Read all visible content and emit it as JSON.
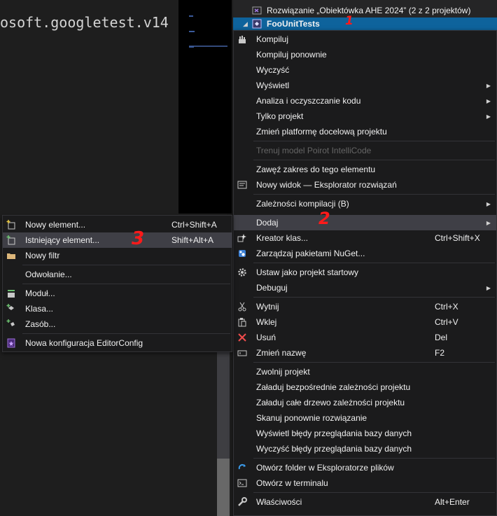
{
  "editor": {
    "code_fragment": "osoft.googletest.v14"
  },
  "solution": {
    "solution_label": "Rozwiązanie „Obiektówka AHE 2024” (2 z 2 projektów)",
    "project_label": "FooUnitTests"
  },
  "context_menu": {
    "items": [
      {
        "label": "Kompiluj",
        "icon": "build-icon"
      },
      {
        "label": "Kompiluj ponownie"
      },
      {
        "label": "Wyczyść"
      },
      {
        "label": "Wyświetl",
        "submenu": true
      },
      {
        "label": "Analiza i oczyszczanie kodu",
        "submenu": true
      },
      {
        "label": "Tylko projekt",
        "submenu": true
      },
      {
        "label": "Zmień platformę docelową projektu"
      },
      {
        "label": "Trenuj model Poirot IntelliCode",
        "disabled": true
      },
      {
        "label": "Zawęź zakres do tego elementu"
      },
      {
        "label": "Nowy widok — Eksplorator rozwiązań",
        "icon": "new-view-icon"
      },
      {
        "label": "Zależności kompilacji (B)",
        "submenu": true
      },
      {
        "label": "Dodaj",
        "submenu": true
      },
      {
        "label": "Kreator klas...",
        "shortcut": "Ctrl+Shift+X",
        "icon": "class-wizard-icon"
      },
      {
        "label": "Zarządzaj pakietami NuGet...",
        "icon": "nuget-icon"
      },
      {
        "label": "Ustaw jako projekt startowy",
        "icon": "gear-icon"
      },
      {
        "label": "Debuguj",
        "submenu": true
      },
      {
        "label": "Wytnij",
        "shortcut": "Ctrl+X",
        "icon": "scissors-icon"
      },
      {
        "label": "Wklej",
        "shortcut": "Ctrl+V",
        "icon": "paste-icon"
      },
      {
        "label": "Usuń",
        "shortcut": "Del",
        "icon": "delete-icon"
      },
      {
        "label": "Zmień nazwę",
        "shortcut": "F2",
        "icon": "rename-icon"
      },
      {
        "label": "Zwolnij projekt"
      },
      {
        "label": "Załaduj bezpośrednie zależności projektu"
      },
      {
        "label": "Załaduj całe drzewo zależności projektu"
      },
      {
        "label": "Skanuj ponownie rozwiązanie"
      },
      {
        "label": "Wyświetl błędy przeglądania bazy danych"
      },
      {
        "label": "Wyczyść błędy przeglądania bazy danych"
      },
      {
        "label": "Otwórz folder w Eksploratorze plików",
        "icon": "refresh-icon"
      },
      {
        "label": "Otwórz w terminalu",
        "icon": "terminal-icon"
      },
      {
        "label": "Właściwości",
        "shortcut": "Alt+Enter",
        "icon": "wrench-icon"
      }
    ]
  },
  "add_submenu": {
    "items": [
      {
        "label": "Nowy element...",
        "shortcut": "Ctrl+Shift+A",
        "icon": "new-item-icon"
      },
      {
        "label": "Istniejący element...",
        "shortcut": "Shift+Alt+A",
        "icon": "existing-item-icon"
      },
      {
        "label": "Nowy filtr",
        "icon": "folder-icon"
      },
      {
        "label": "Odwołanie..."
      },
      {
        "label": "Moduł...",
        "icon": "module-icon"
      },
      {
        "label": "Klasa...",
        "icon": "class-icon"
      },
      {
        "label": "Zasób...",
        "icon": "resource-icon"
      },
      {
        "label": "Nowa konfiguracja EditorConfig",
        "icon": "editorconfig-icon"
      }
    ]
  },
  "annotations": {
    "step1": "1",
    "step2": "2",
    "step3": "3"
  },
  "colors": {
    "selection": "#0e639c",
    "hover": "#3f3f46",
    "annotation": "#ff1a1a",
    "menu_bg": "#1b1b1c"
  }
}
